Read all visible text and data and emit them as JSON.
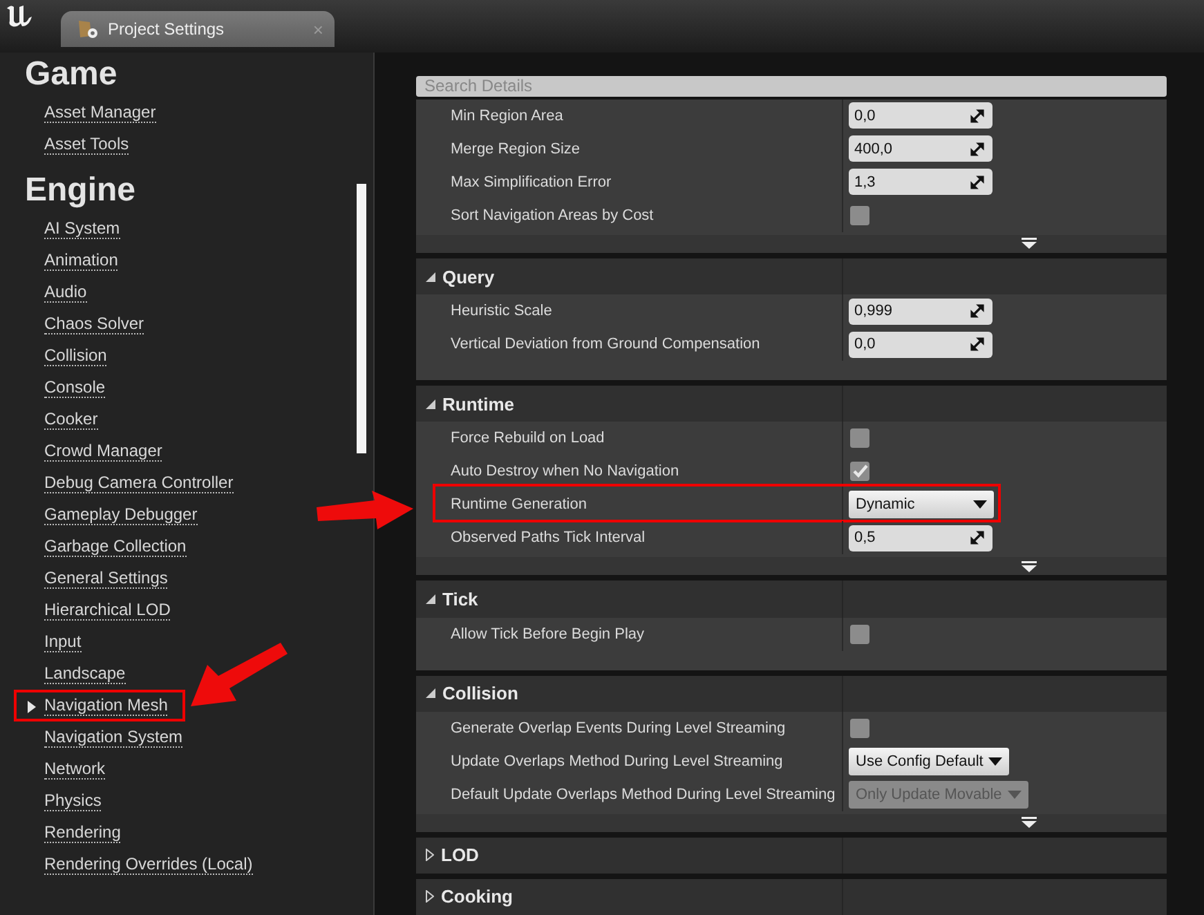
{
  "window": {
    "tab_title": "Project Settings",
    "tab_close": "×"
  },
  "sidebar": {
    "groups": [
      {
        "title": "Game",
        "items": [
          {
            "label": "Asset Manager",
            "selected": false,
            "highlighted": false
          },
          {
            "label": "Asset Tools",
            "selected": false,
            "highlighted": false
          }
        ]
      },
      {
        "title": "Engine",
        "items": [
          {
            "label": "AI System",
            "selected": false,
            "highlighted": false
          },
          {
            "label": "Animation",
            "selected": false,
            "highlighted": false
          },
          {
            "label": "Audio",
            "selected": false,
            "highlighted": false
          },
          {
            "label": "Chaos Solver",
            "selected": false,
            "highlighted": false
          },
          {
            "label": "Collision",
            "selected": false,
            "highlighted": false
          },
          {
            "label": "Console",
            "selected": false,
            "highlighted": false
          },
          {
            "label": "Cooker",
            "selected": false,
            "highlighted": false
          },
          {
            "label": "Crowd Manager",
            "selected": false,
            "highlighted": false
          },
          {
            "label": "Debug Camera Controller",
            "selected": false,
            "highlighted": false
          },
          {
            "label": "Gameplay Debugger",
            "selected": false,
            "highlighted": false
          },
          {
            "label": "Garbage Collection",
            "selected": false,
            "highlighted": false
          },
          {
            "label": "General Settings",
            "selected": false,
            "highlighted": false
          },
          {
            "label": "Hierarchical LOD",
            "selected": false,
            "highlighted": false
          },
          {
            "label": "Input",
            "selected": false,
            "highlighted": false
          },
          {
            "label": "Landscape",
            "selected": false,
            "highlighted": false
          },
          {
            "label": "Navigation Mesh",
            "selected": true,
            "highlighted": true
          },
          {
            "label": "Navigation System",
            "selected": false,
            "highlighted": false
          },
          {
            "label": "Network",
            "selected": false,
            "highlighted": false
          },
          {
            "label": "Physics",
            "selected": false,
            "highlighted": false
          },
          {
            "label": "Rendering",
            "selected": false,
            "highlighted": false
          },
          {
            "label": "Rendering Overrides (Local)",
            "selected": false,
            "highlighted": false
          }
        ]
      }
    ]
  },
  "details": {
    "search": {
      "placeholder": "Search Details"
    },
    "sections": [
      {
        "advanced": true,
        "rows": [
          {
            "label": "Min Region Area",
            "kind": "number",
            "value": "0,0",
            "highlighted": false
          },
          {
            "label": "Merge Region Size",
            "kind": "number",
            "value": "400,0",
            "highlighted": false
          },
          {
            "label": "Max Simplification Error",
            "kind": "number",
            "value": "1,3",
            "highlighted": false
          },
          {
            "label": "Sort Navigation Areas by Cost",
            "kind": "checkbox",
            "checked": false,
            "highlighted": false
          }
        ]
      },
      {
        "title": "Query",
        "expanded": true,
        "advanced": false,
        "rows": [
          {
            "label": "Heuristic Scale",
            "kind": "number",
            "value": "0,999",
            "highlighted": false
          },
          {
            "label": "Vertical Deviation from Ground Compensation",
            "kind": "number",
            "value": "0,0",
            "highlighted": false
          }
        ]
      },
      {
        "title": "Runtime",
        "expanded": true,
        "advanced": true,
        "rows": [
          {
            "label": "Force Rebuild on Load",
            "kind": "checkbox",
            "checked": false,
            "highlighted": false
          },
          {
            "label": "Auto Destroy when No Navigation",
            "kind": "checkbox",
            "checked": true,
            "highlighted": false
          },
          {
            "label": "Runtime Generation",
            "kind": "dropdown",
            "value": "Dynamic",
            "disabled": false,
            "highlighted": true
          },
          {
            "label": "Observed Paths Tick Interval",
            "kind": "number",
            "value": "0,5",
            "highlighted": false
          }
        ]
      },
      {
        "title": "Tick",
        "expanded": true,
        "advanced": false,
        "rows": [
          {
            "label": "Allow Tick Before Begin Play",
            "kind": "checkbox",
            "checked": false,
            "highlighted": false
          }
        ]
      },
      {
        "title": "Collision",
        "expanded": true,
        "advanced": true,
        "rows": [
          {
            "label": "Generate Overlap Events During Level Streaming",
            "kind": "checkbox",
            "checked": false,
            "highlighted": false
          },
          {
            "label": "Update Overlaps Method During Level Streaming",
            "kind": "dropdown",
            "value": "Use Config Default",
            "disabled": false,
            "highlighted": false
          },
          {
            "label": "Default Update Overlaps Method During Level Streaming",
            "kind": "dropdown",
            "value": "Only Update Movable",
            "disabled": true,
            "highlighted": false
          }
        ]
      },
      {
        "title": "LOD",
        "expanded": false,
        "advanced": false
      },
      {
        "title": "Cooking",
        "expanded": false,
        "advanced": false
      }
    ]
  }
}
